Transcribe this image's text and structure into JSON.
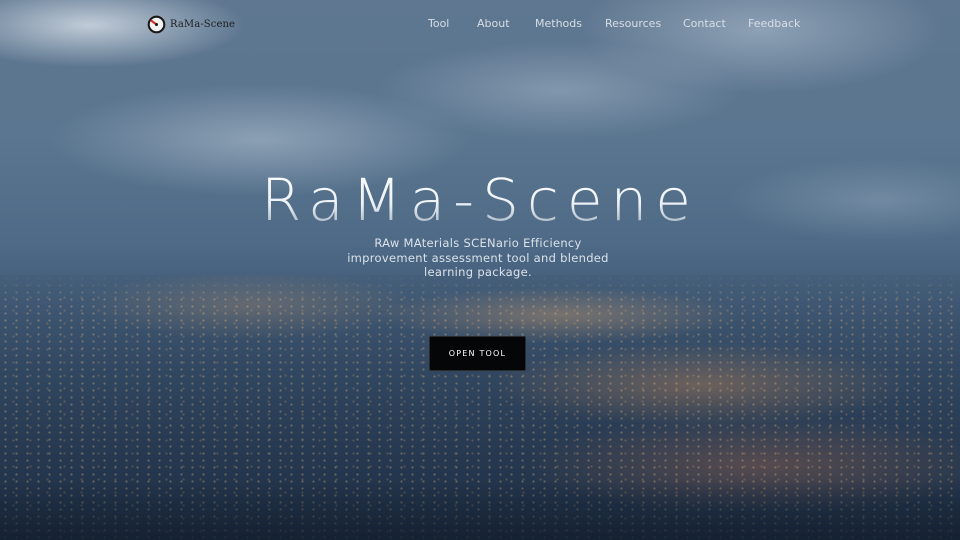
{
  "brand": {
    "logo_text": "RaMa-Scene",
    "logo_icon": "gauge-icon",
    "logo_colors": {
      "ring": "#1a1a1a",
      "needle": "#d93025"
    }
  },
  "nav": {
    "items": [
      {
        "label": "Tool"
      },
      {
        "label": "About"
      },
      {
        "label": "Methods"
      },
      {
        "label": "Resources"
      },
      {
        "label": "Contact"
      },
      {
        "label": "Feedback"
      }
    ]
  },
  "hero": {
    "title": "RaMa-Scene",
    "subtitle": "RAw MAterials SCENario Efficiency improvement assessment tool and blended learning package.",
    "cta_label": "OPEN TOOL",
    "background": "night-city-under-clouds"
  },
  "colors": {
    "nav_text": "#d7dee6",
    "button_bg": "#050608",
    "button_text": "#ffffff"
  }
}
